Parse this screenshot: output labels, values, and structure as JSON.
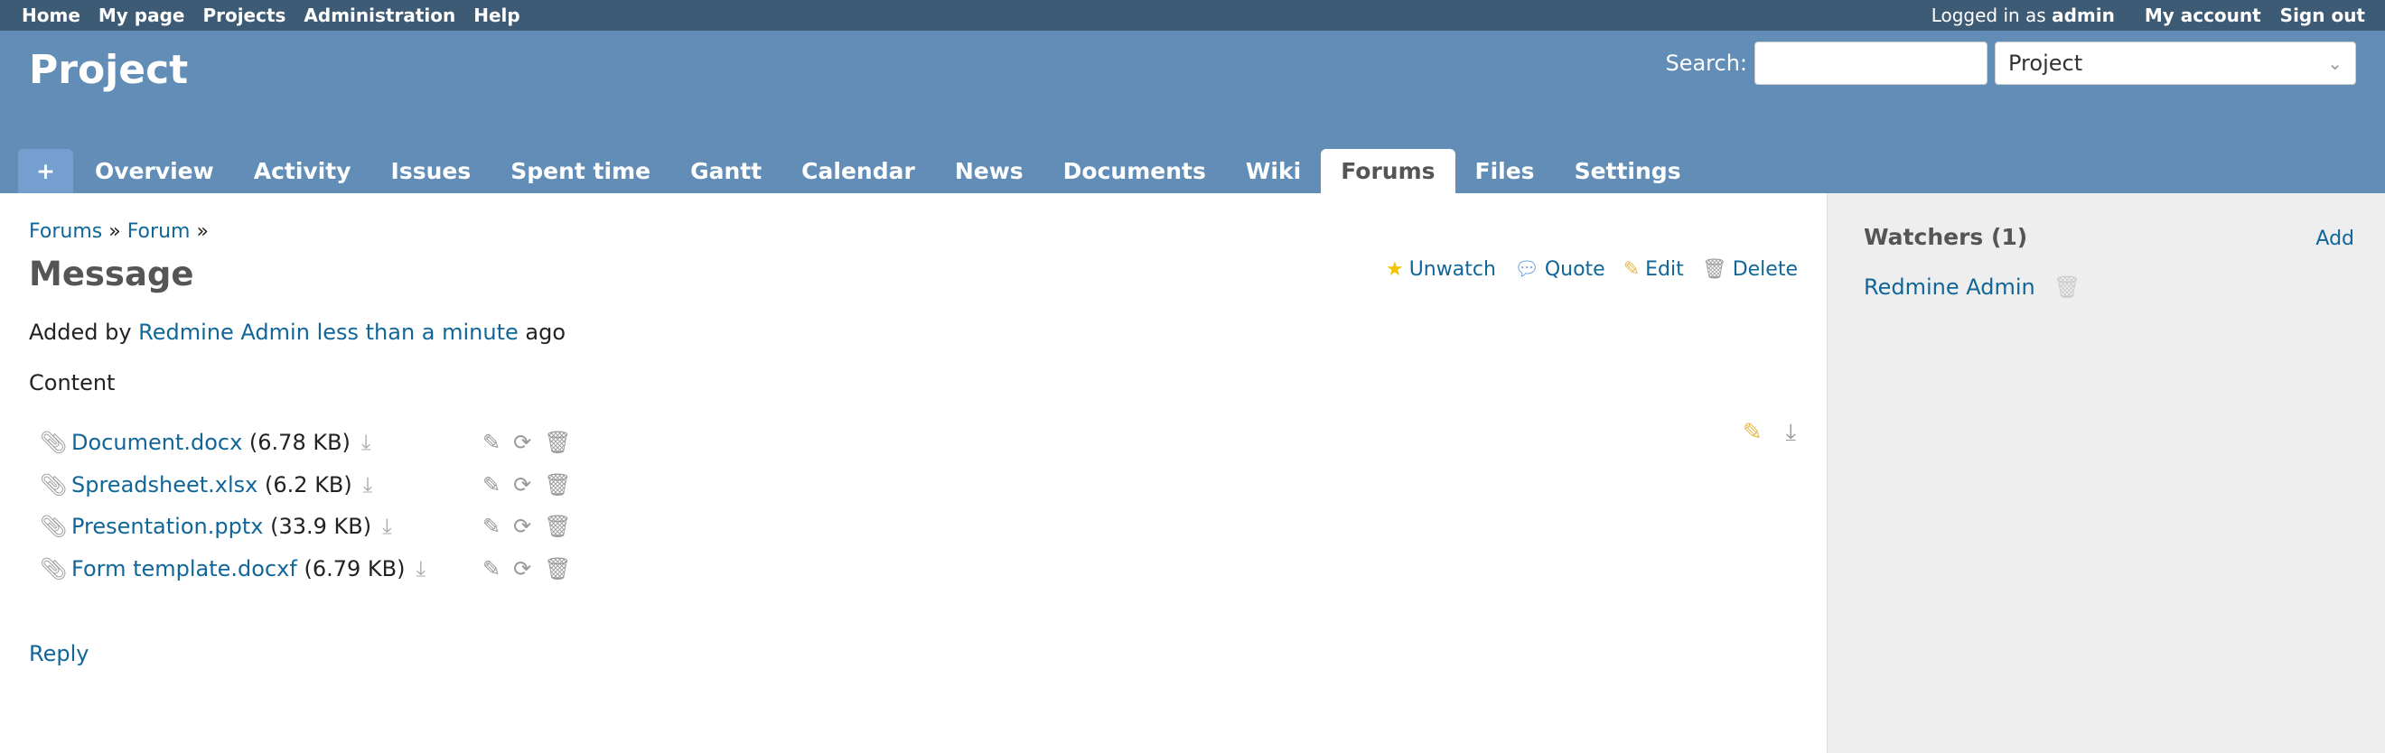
{
  "top_menu": {
    "items": [
      "Home",
      "My page",
      "Projects",
      "Administration",
      "Help"
    ],
    "logged_in_prefix": "Logged in as",
    "user": "admin",
    "my_account": "My account",
    "sign_out": "Sign out"
  },
  "header": {
    "title": "Project",
    "search_label": "Search:",
    "search_value": "",
    "scope": "Project"
  },
  "tabs": [
    "+",
    "Overview",
    "Activity",
    "Issues",
    "Spent time",
    "Gantt",
    "Calendar",
    "News",
    "Documents",
    "Wiki",
    "Forums",
    "Files",
    "Settings"
  ],
  "selected_tab": "Forums",
  "breadcrumb": {
    "forums": "Forums",
    "forum": "Forum",
    "sep": "»"
  },
  "message": {
    "title": "Message",
    "added_by": "Added by",
    "author": "Redmine Admin",
    "time": "less than a minute",
    "ago": "ago",
    "content": "Content"
  },
  "actions": {
    "unwatch": "Unwatch",
    "quote": "Quote",
    "edit": "Edit",
    "delete": "Delete"
  },
  "attachments": [
    {
      "name": "Document.docx",
      "size": "(6.78 KB)"
    },
    {
      "name": "Spreadsheet.xlsx",
      "size": "(6.2 KB)"
    },
    {
      "name": "Presentation.pptx",
      "size": "(33.9 KB)"
    },
    {
      "name": "Form template.docxf",
      "size": "(6.79 KB)"
    }
  ],
  "reply": "Reply",
  "sidebar": {
    "watchers_title": "Watchers (1)",
    "add": "Add",
    "watchers": [
      "Redmine Admin"
    ]
  },
  "colors": {
    "top_menu": "#3e5b76",
    "header": "#628db6",
    "link": "#116699",
    "sidebar": "#eeeeee"
  }
}
